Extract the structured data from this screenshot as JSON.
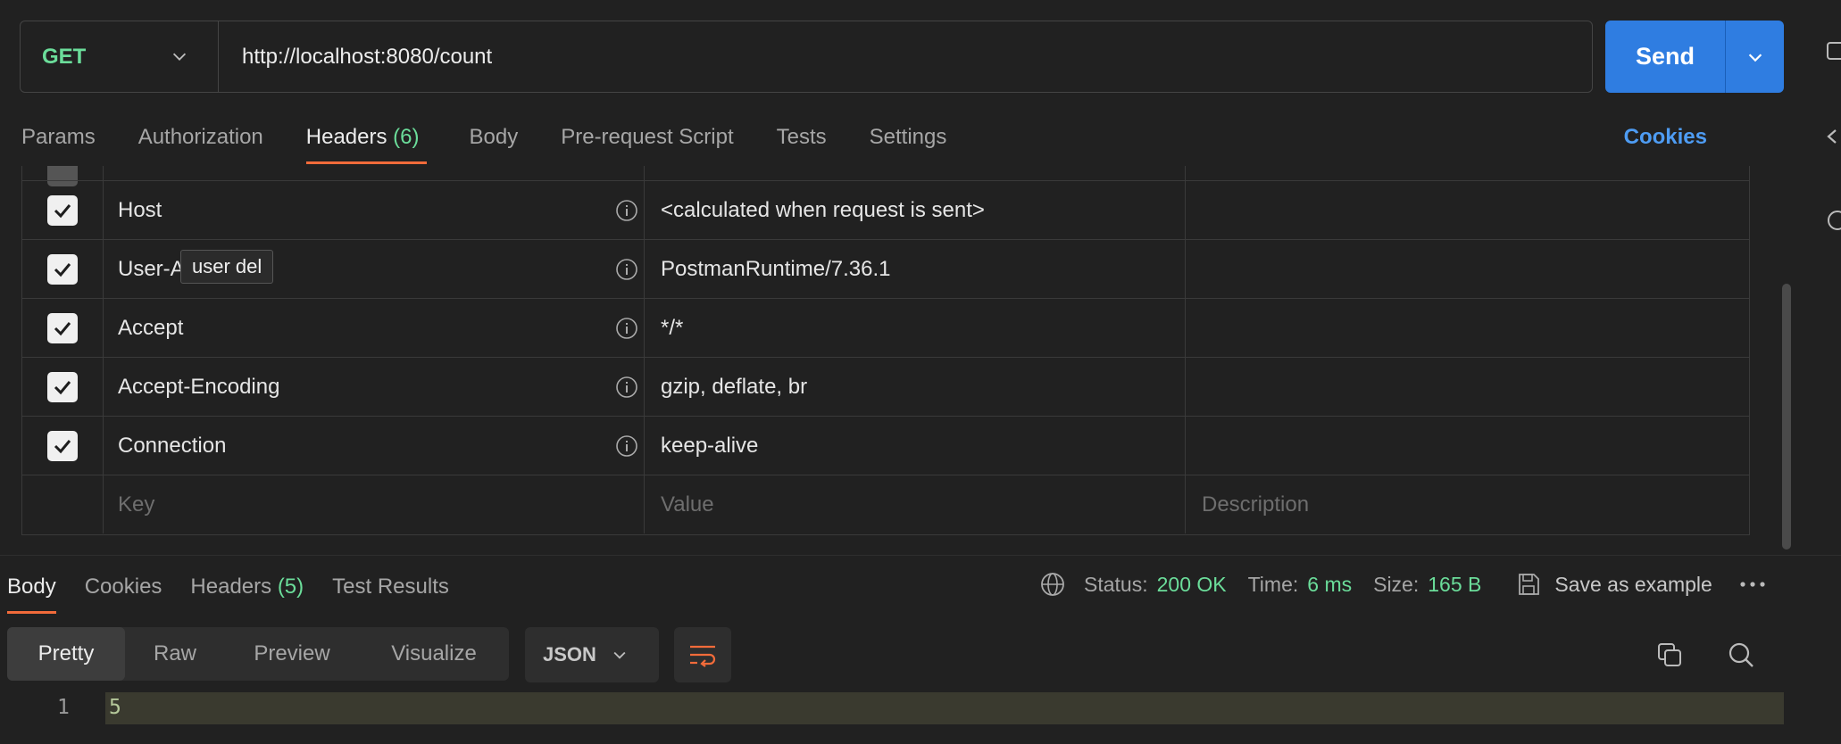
{
  "request": {
    "method": "GET",
    "url": "http://localhost:8080/count",
    "send_label": "Send"
  },
  "request_tabs": [
    {
      "label": "Params"
    },
    {
      "label": "Authorization"
    },
    {
      "label": "Headers",
      "count": "(6)"
    },
    {
      "label": "Body"
    },
    {
      "label": "Pre-request Script"
    },
    {
      "label": "Tests"
    },
    {
      "label": "Settings"
    }
  ],
  "cookies_link": "Cookies",
  "headers": [
    {
      "key": "Host",
      "value": "<calculated when request is sent>",
      "checked": true
    },
    {
      "key": "User-A",
      "value": "PostmanRuntime/7.36.1",
      "checked": true
    },
    {
      "key": "Accept",
      "value": "*/*",
      "checked": true
    },
    {
      "key": "Accept-Encoding",
      "value": "gzip, deflate, br",
      "checked": true
    },
    {
      "key": "Connection",
      "value": "keep-alive",
      "checked": true
    }
  ],
  "new_row": {
    "key": "Key",
    "value": "Value",
    "description": "Description"
  },
  "tooltip": "user del",
  "response_tabs": [
    {
      "label": "Body"
    },
    {
      "label": "Cookies"
    },
    {
      "label": "Headers",
      "count": "(5)"
    },
    {
      "label": "Test Results"
    }
  ],
  "status": {
    "status_label": "Status:",
    "status_value": "200 OK",
    "time_label": "Time:",
    "time_value": "6 ms",
    "size_label": "Size:",
    "size_value": "165 B",
    "save_example": "Save as example"
  },
  "view_modes": [
    "Pretty",
    "Raw",
    "Preview",
    "Visualize"
  ],
  "format": "JSON",
  "body_lines": [
    {
      "no": "1",
      "text": "5"
    }
  ],
  "colors": {
    "accent": "#f26b3a",
    "send": "#2f7de1",
    "green": "#6bdd9a",
    "link": "#4e9cf3"
  }
}
